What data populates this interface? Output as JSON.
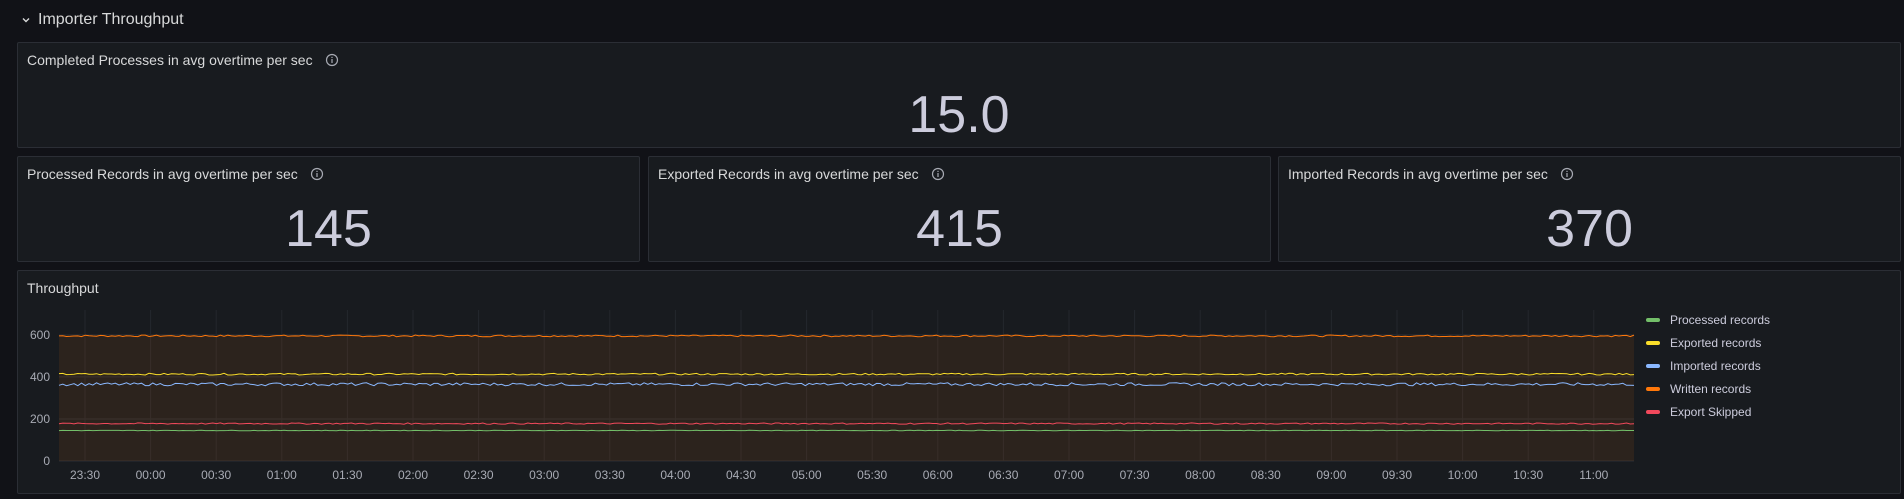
{
  "row": {
    "title": "Importer Throughput"
  },
  "panels": {
    "completed": {
      "title": "Completed Processes in avg overtime per sec",
      "value": "15.0"
    },
    "processed": {
      "title": "Processed Records in avg overtime per sec",
      "value": "145"
    },
    "exported": {
      "title": "Exported Records in avg overtime per sec",
      "value": "415"
    },
    "imported": {
      "title": "Imported Records in avg overtime per sec",
      "value": "370"
    }
  },
  "throughput": {
    "title": "Throughput",
    "legend": [
      {
        "label": "Processed records",
        "color": "#73bf69"
      },
      {
        "label": "Exported records",
        "color": "#fade2a"
      },
      {
        "label": "Imported records",
        "color": "#8ab8ff"
      },
      {
        "label": "Written records",
        "color": "#ff780a"
      },
      {
        "label": "Export Skipped",
        "color": "#f2495c"
      }
    ]
  },
  "chart_data": {
    "type": "line",
    "title": "Throughput",
    "x": [
      "23:30",
      "00:00",
      "00:30",
      "01:00",
      "01:30",
      "02:00",
      "02:30",
      "03:00",
      "03:30",
      "04:00",
      "04:30",
      "05:00",
      "05:30",
      "06:00",
      "06:30",
      "07:00",
      "07:30",
      "08:00",
      "08:30",
      "09:00",
      "09:30",
      "10:00",
      "10:30",
      "11:00"
    ],
    "yticks": [
      0,
      200,
      400,
      600
    ],
    "ylim": [
      0,
      680
    ],
    "grid": true,
    "legend_position": "right",
    "series": [
      {
        "name": "Written records",
        "color": "#ff780a",
        "value": 595,
        "noise": 4,
        "fill": true
      },
      {
        "name": "Exported records",
        "color": "#fade2a",
        "value": 413,
        "noise": 4,
        "fill": false
      },
      {
        "name": "Imported records",
        "color": "#8ab8ff",
        "value": 365,
        "noise": 7,
        "fill": false
      },
      {
        "name": "Export Skipped",
        "color": "#f2495c",
        "value": 178,
        "noise": 3,
        "fill": false
      },
      {
        "name": "Processed records",
        "color": "#73bf69",
        "value": 145,
        "noise": 1,
        "fill": false
      }
    ]
  }
}
